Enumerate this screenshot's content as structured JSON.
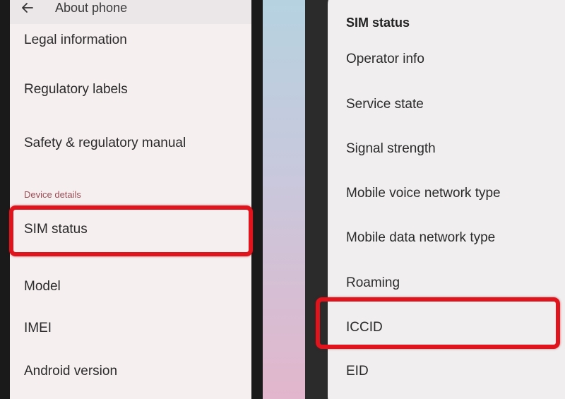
{
  "left_panel": {
    "header_title": "About phone",
    "items": [
      {
        "label": "Legal information"
      },
      {
        "label": "Regulatory labels"
      },
      {
        "label": "Safety & regulatory manual"
      }
    ],
    "section_header": "Device details",
    "details": [
      {
        "label": "SIM status"
      },
      {
        "label": "Model"
      },
      {
        "label": "IMEI"
      },
      {
        "label": "Android version"
      }
    ]
  },
  "right_panel": {
    "dialog_title": "SIM status",
    "items": [
      {
        "label": "Operator info"
      },
      {
        "label": "Service state"
      },
      {
        "label": "Signal strength"
      },
      {
        "label": "Mobile voice network type"
      },
      {
        "label": "Mobile data network type"
      },
      {
        "label": "Roaming"
      },
      {
        "label": "ICCID"
      },
      {
        "label": "EID"
      }
    ]
  },
  "colors": {
    "highlight": "#e0141c",
    "section_header": "#9a4d55"
  },
  "icons": {
    "back": "arrow-left-icon"
  }
}
